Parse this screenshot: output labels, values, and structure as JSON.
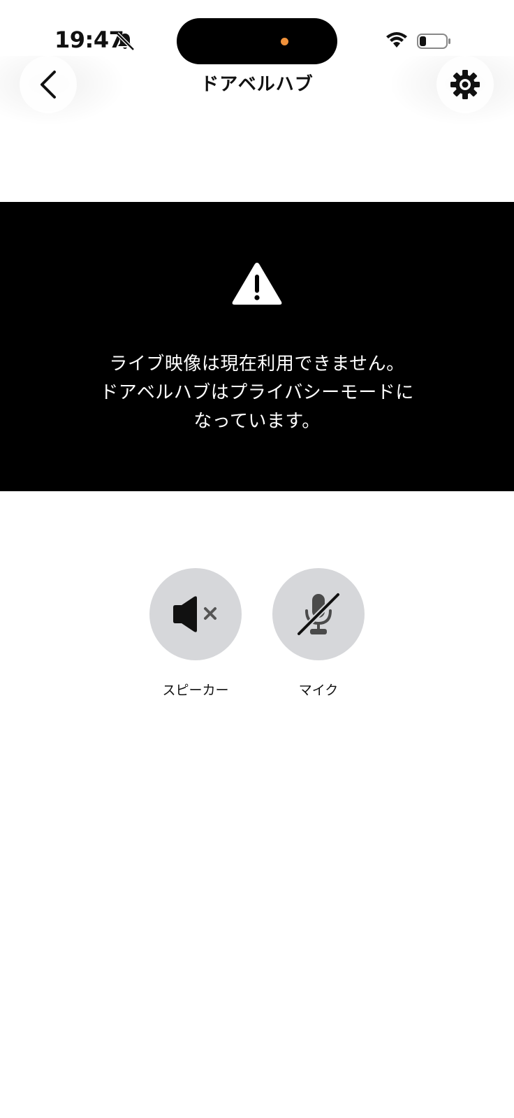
{
  "status_bar": {
    "time": "19:47",
    "icons": [
      "bell-slash-icon",
      "wifi-icon",
      "battery-icon"
    ],
    "island_dot_color": "#f0913a"
  },
  "nav": {
    "title": "ドアベルハブ",
    "back_icon": "chevron-left-icon",
    "settings_icon": "gear-icon"
  },
  "video": {
    "icon": "warning-triangle-icon",
    "message": "ライブ映像は現在利用できません。\nドアベルハブはプライバシーモードに\nなっています。"
  },
  "controls": {
    "speaker": {
      "label": "スピーカー",
      "icon": "speaker-muted-icon",
      "state": "muted"
    },
    "mic": {
      "label": "マイク",
      "icon": "mic-off-icon",
      "state": "off"
    }
  },
  "colors": {
    "video_background": "#000000",
    "control_background": "#d6d7da",
    "accent_dot": "#f0913a"
  }
}
